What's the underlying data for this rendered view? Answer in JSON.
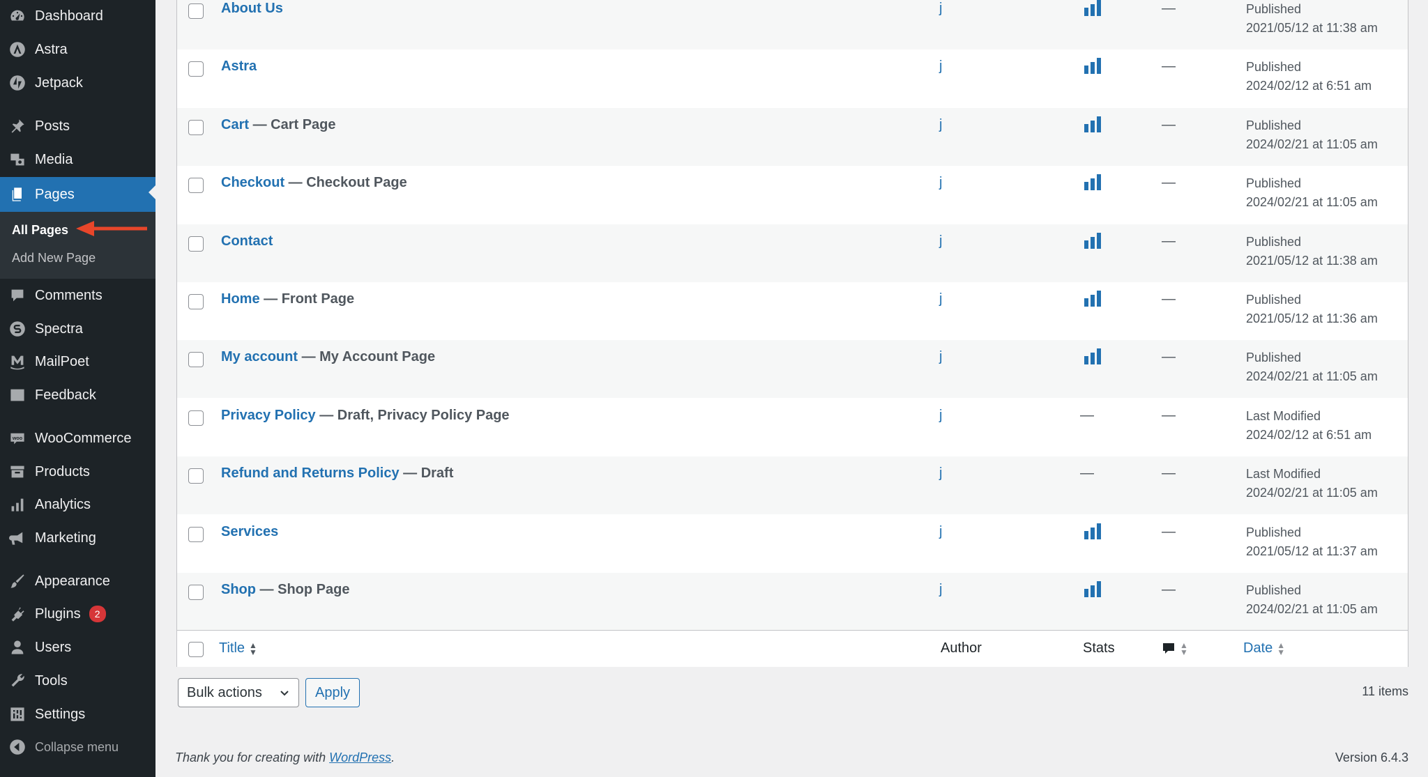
{
  "sidebar": {
    "items": [
      {
        "label": "Dashboard",
        "icon": "dashboard-icon"
      },
      {
        "label": "Astra",
        "icon": "astra-icon"
      },
      {
        "label": "Jetpack",
        "icon": "jetpack-icon"
      },
      {
        "label": "Posts",
        "icon": "pin-icon"
      },
      {
        "label": "Media",
        "icon": "media-icon"
      },
      {
        "label": "Pages",
        "icon": "pages-icon"
      },
      {
        "label": "Comments",
        "icon": "comment-icon"
      },
      {
        "label": "Spectra",
        "icon": "spectra-icon"
      },
      {
        "label": "MailPoet",
        "icon": "mailpoet-icon"
      },
      {
        "label": "Feedback",
        "icon": "feedback-icon"
      },
      {
        "label": "WooCommerce",
        "icon": "woo-icon"
      },
      {
        "label": "Products",
        "icon": "archive-icon"
      },
      {
        "label": "Analytics",
        "icon": "bar-chart-icon"
      },
      {
        "label": "Marketing",
        "icon": "megaphone-icon"
      },
      {
        "label": "Appearance",
        "icon": "brush-icon"
      },
      {
        "label": "Plugins",
        "icon": "plugin-icon",
        "badge": "2"
      },
      {
        "label": "Users",
        "icon": "user-icon"
      },
      {
        "label": "Tools",
        "icon": "wrench-icon"
      },
      {
        "label": "Settings",
        "icon": "settings-icon"
      }
    ],
    "submenu": {
      "all_pages": "All Pages",
      "add_new": "Add New Page"
    },
    "collapse": "Collapse menu"
  },
  "table": {
    "rows": [
      {
        "title": "About Us",
        "suffix": "",
        "author": "j",
        "stats": true,
        "comments": "—",
        "status": "Published",
        "date": "2021/05/12 at 11:38 am"
      },
      {
        "title": "Astra",
        "suffix": "",
        "author": "j",
        "stats": true,
        "comments": "—",
        "status": "Published",
        "date": "2024/02/12 at 6:51 am"
      },
      {
        "title": "Cart",
        "suffix": " — Cart Page",
        "author": "j",
        "stats": true,
        "comments": "—",
        "status": "Published",
        "date": "2024/02/21 at 11:05 am"
      },
      {
        "title": "Checkout",
        "suffix": " — Checkout Page",
        "author": "j",
        "stats": true,
        "comments": "—",
        "status": "Published",
        "date": "2024/02/21 at 11:05 am"
      },
      {
        "title": "Contact",
        "suffix": "",
        "author": "j",
        "stats": true,
        "comments": "—",
        "status": "Published",
        "date": "2021/05/12 at 11:38 am"
      },
      {
        "title": "Home",
        "suffix": " — Front Page",
        "author": "j",
        "stats": true,
        "comments": "—",
        "status": "Published",
        "date": "2021/05/12 at 11:36 am"
      },
      {
        "title": "My account",
        "suffix": " — My Account Page",
        "author": "j",
        "stats": true,
        "comments": "—",
        "status": "Published",
        "date": "2024/02/21 at 11:05 am"
      },
      {
        "title": "Privacy Policy",
        "suffix": " — Draft, Privacy Policy Page",
        "author": "j",
        "stats": false,
        "stats_text": "—",
        "comments": "—",
        "status": "Last Modified",
        "date": "2024/02/12 at 6:51 am"
      },
      {
        "title": "Refund and Returns Policy",
        "suffix": " — Draft",
        "author": "j",
        "stats": false,
        "stats_text": "—",
        "comments": "—",
        "status": "Last Modified",
        "date": "2024/02/21 at 11:05 am"
      },
      {
        "title": "Services",
        "suffix": "",
        "author": "j",
        "stats": true,
        "comments": "—",
        "status": "Published",
        "date": "2021/05/12 at 11:37 am"
      },
      {
        "title": "Shop",
        "suffix": " — Shop Page",
        "author": "j",
        "stats": true,
        "comments": "—",
        "status": "Published",
        "date": "2024/02/21 at 11:05 am"
      }
    ],
    "columns": {
      "title": "Title",
      "author": "Author",
      "stats": "Stats",
      "date": "Date"
    }
  },
  "bulk_actions": {
    "selected": "Bulk actions",
    "apply": "Apply"
  },
  "items_count": "11 items",
  "footer": {
    "thanks_prefix": "Thank you for creating with ",
    "wordpress_link": "WordPress",
    "thanks_suffix": ".",
    "version": "Version 6.4.3"
  },
  "colors": {
    "sidebar_bg": "#1d2327",
    "accent": "#2271b1",
    "badge": "#d63638",
    "arrow": "#e8462a"
  }
}
